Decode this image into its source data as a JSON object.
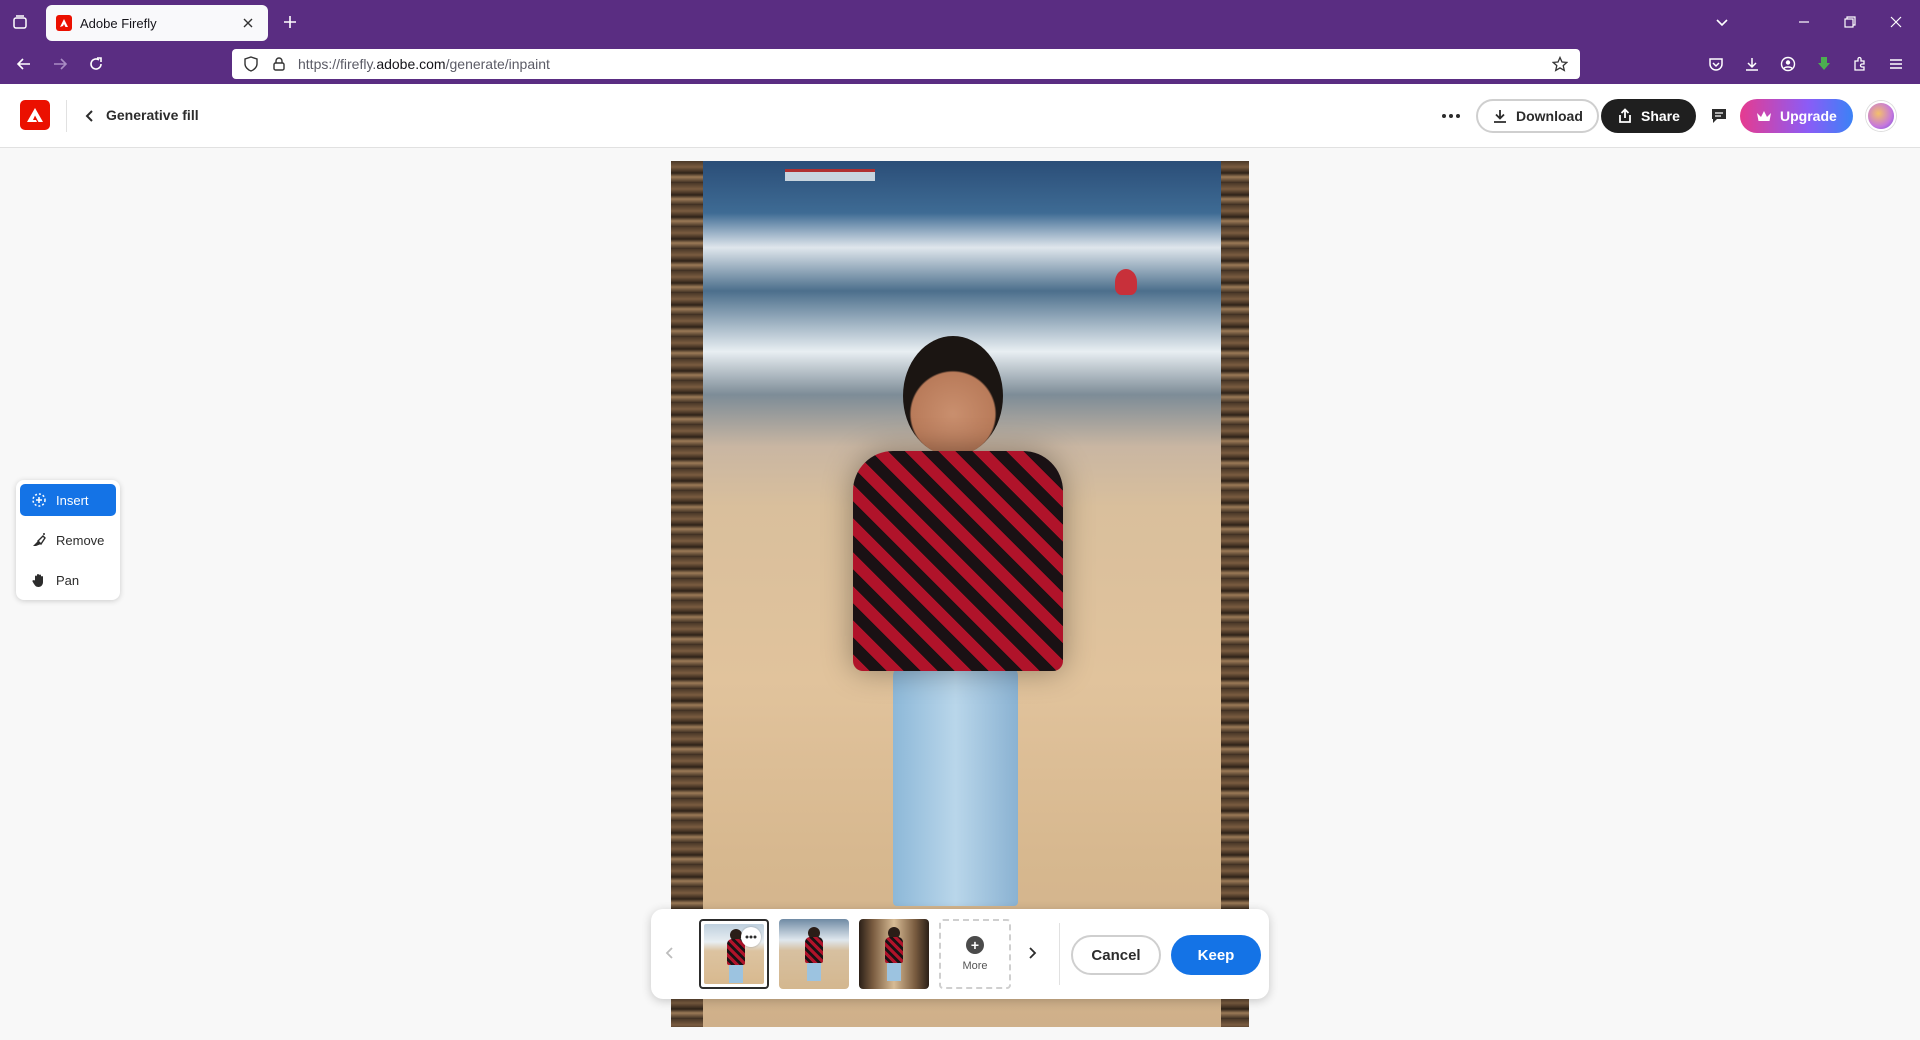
{
  "browser": {
    "tab_title": "Adobe Firefly",
    "url_prefix": "https://firefly.",
    "url_domain": "adobe.com",
    "url_path": "/generate/inpaint"
  },
  "header": {
    "page_title": "Generative fill",
    "download_label": "Download",
    "share_label": "Share",
    "upgrade_label": "Upgrade"
  },
  "tools": {
    "items": [
      {
        "label": "Insert",
        "icon": "insert-icon",
        "active": true
      },
      {
        "label": "Remove",
        "icon": "eraser-icon",
        "active": false
      },
      {
        "label": "Pan",
        "icon": "hand-icon",
        "active": false
      }
    ]
  },
  "variations": {
    "more_label": "More",
    "cancel_label": "Cancel",
    "keep_label": "Keep",
    "selected_index": 0
  },
  "colors": {
    "browser_chrome": "#5a2d82",
    "accent_blue": "#1473e6",
    "adobe_red": "#eb1000"
  }
}
